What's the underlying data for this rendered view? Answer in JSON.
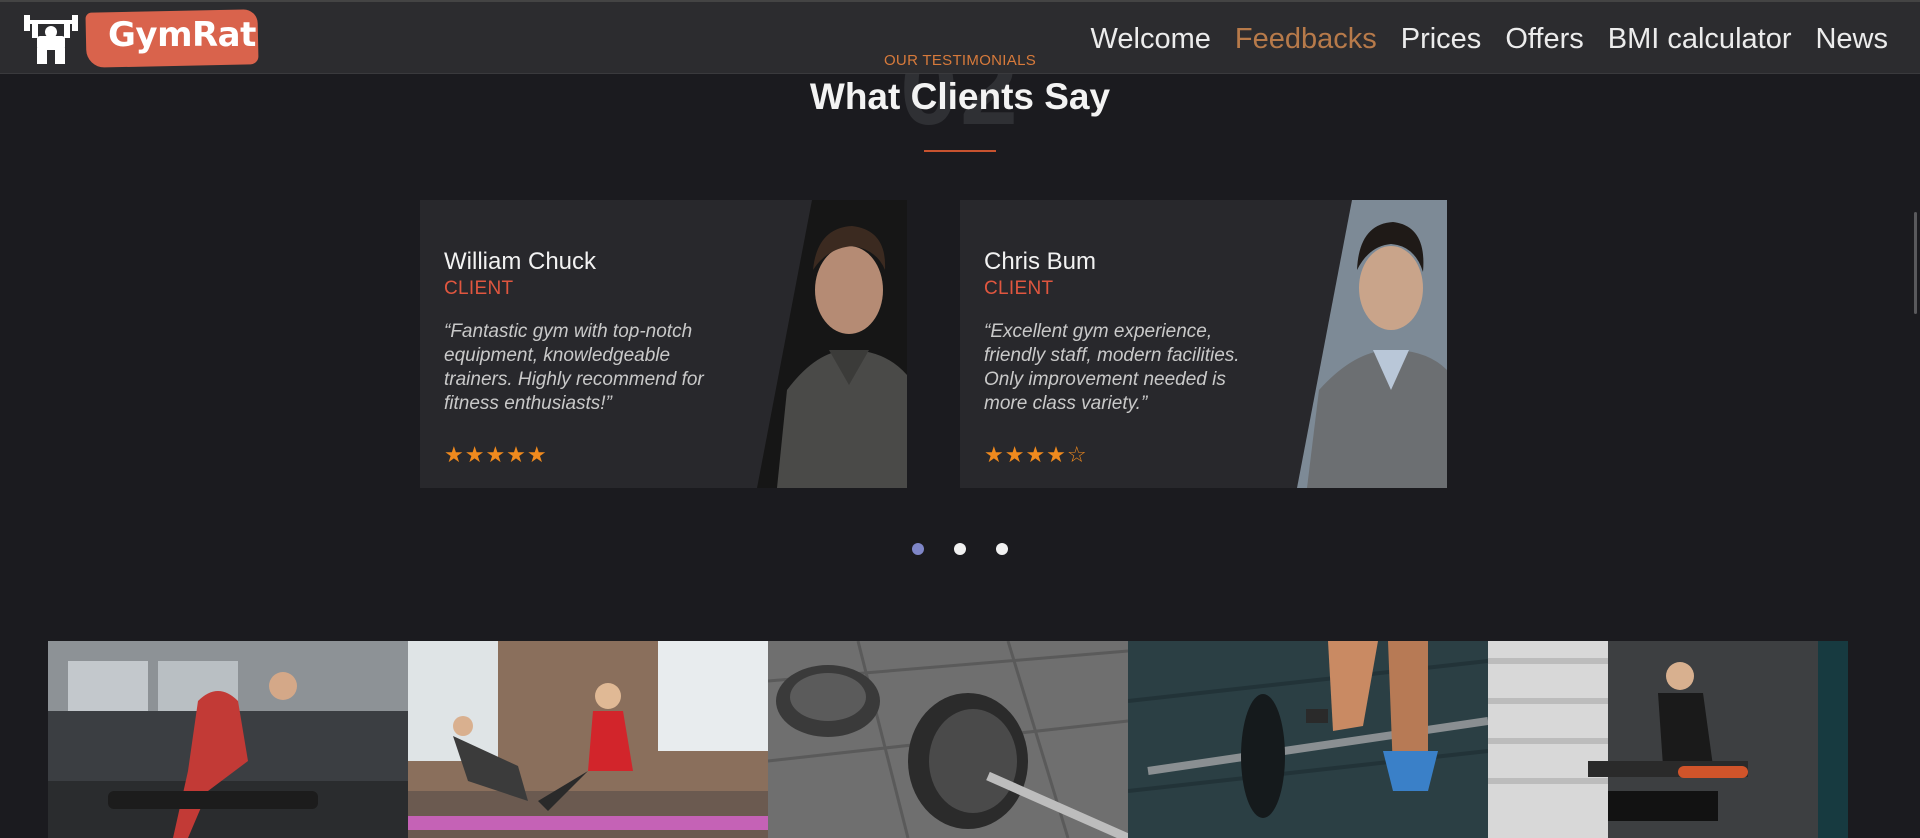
{
  "brand": {
    "name": "GymRat",
    "accent": "#d9634c"
  },
  "nav": {
    "items": [
      {
        "label": "Welcome"
      },
      {
        "label": "Feedbacks",
        "active": true
      },
      {
        "label": "Prices"
      },
      {
        "label": "Offers"
      },
      {
        "label": "BMI calculator"
      },
      {
        "label": "News"
      }
    ],
    "active_color": "#b77a4a"
  },
  "section": {
    "eyebrow": "OUR TESTIMONIALS",
    "number": "02",
    "title": "What Clients Say"
  },
  "testimonials": [
    {
      "name": "William Chuck",
      "role": "CLIENT",
      "quote": "“Fantastic gym with top-notch equipment, knowledgeable trainers. Highly recommend for fitness enthusiasts!”",
      "rating": 5,
      "stars": "★★★★★",
      "photo_icon": "man-portrait-dark-sweater"
    },
    {
      "name": "Chris Bum",
      "role": "CLIENT",
      "quote": "“Excellent gym experience, friendly staff, modern facilities. Only improvement needed is more class variety.”",
      "rating": 4,
      "stars": "★★★★☆",
      "photo_icon": "man-portrait-grey-sweater"
    }
  ],
  "carousel": {
    "pages": 3,
    "active_index": 0
  },
  "gallery": [
    {
      "subject": "woman-dumbbell-row"
    },
    {
      "subject": "women-yoga-mats"
    },
    {
      "subject": "barbell-plates-floor"
    },
    {
      "subject": "barbell-deadlift"
    },
    {
      "subject": "man-resting-on-bench"
    }
  ]
}
